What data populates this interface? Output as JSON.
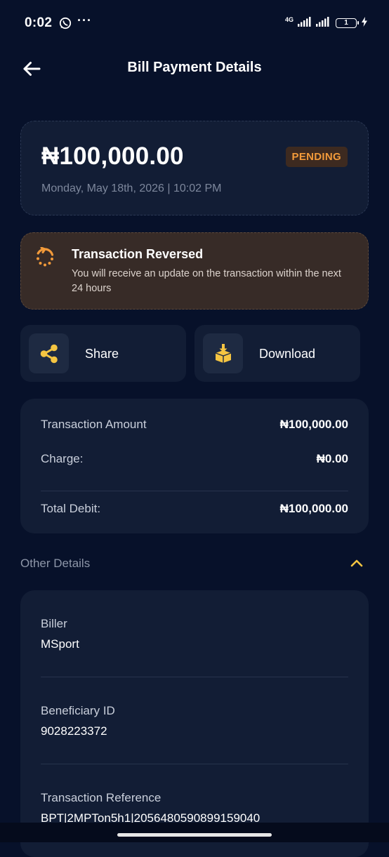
{
  "status_bar": {
    "time": "0:02",
    "dots": "···",
    "network": "4G",
    "battery": "1"
  },
  "header": {
    "title": "Bill Payment Details"
  },
  "summary": {
    "amount": "₦100,000.00",
    "status": "PENDING",
    "date": "Monday, May 18th, 2026 | 10:02 PM"
  },
  "notice": {
    "title": "Transaction Reversed",
    "message": "You will receive an update on the transaction within the next 24 hours"
  },
  "actions": {
    "share_label": "Share",
    "download_label": "Download"
  },
  "breakdown": {
    "rows": [
      {
        "label": "Transaction Amount",
        "value": "₦100,000.00"
      },
      {
        "label": "Charge:",
        "value": "₦0.00"
      }
    ],
    "total": {
      "label": "Total Debit:",
      "value": "₦100,000.00"
    }
  },
  "other_details": {
    "title": "Other Details",
    "fields": [
      {
        "label": "Biller",
        "value": "MSport"
      },
      {
        "label": "Beneficiary ID",
        "value": "9028223372"
      },
      {
        "label": "Transaction Reference",
        "value": "BPT|2MPTon5h1|2056480590899159040"
      }
    ]
  },
  "colors": {
    "background": "#07112a",
    "card": "#121d35",
    "pending": "#f29a3a",
    "accent_yellow": "#f5c542"
  },
  "icons": [
    "back-arrow-icon",
    "whatsapp-icon",
    "signal-icon",
    "battery-icon",
    "charging-icon",
    "reverse-icon",
    "share-icon",
    "download-icon",
    "chevron-up-icon"
  ]
}
